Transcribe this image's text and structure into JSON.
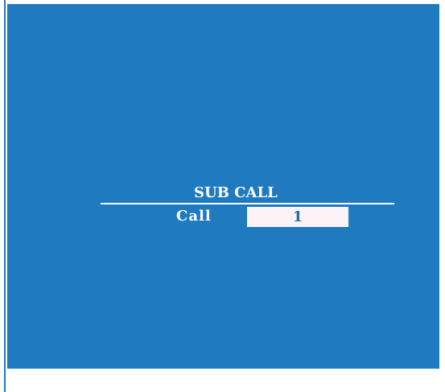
{
  "dialog": {
    "title": "SUB CALL",
    "field_label": "Call",
    "field_value": "1"
  },
  "colors": {
    "background": "#1f7ac0",
    "text": "#ffffff",
    "input_background": "#fbf3f6",
    "input_text": "#1f6fb5"
  }
}
